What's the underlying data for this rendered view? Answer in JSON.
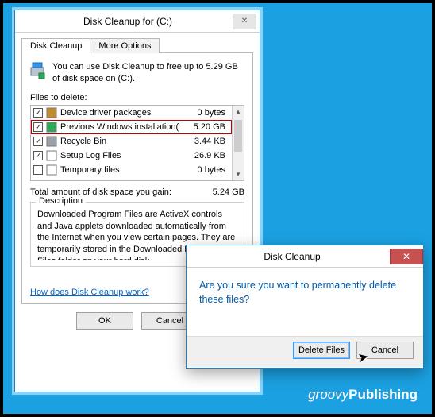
{
  "main_window": {
    "title": "Disk Cleanup for  (C:)",
    "close_glyph": "✕",
    "tabs": {
      "t1": "Disk Cleanup",
      "t2": "More Options"
    },
    "intro_line": "You can use Disk Cleanup to free up to 5.29 GB of disk space on  (C:).",
    "files_to_delete_label": "Files to delete:",
    "rows": [
      {
        "name": "Device driver packages",
        "size": "0 bytes",
        "checked": true,
        "iconColor": "#c08b2f"
      },
      {
        "name": "Previous Windows installation(s)",
        "size": "5.20 GB",
        "checked": true,
        "iconColor": "#2fa85a",
        "highlight": true
      },
      {
        "name": "Recycle Bin",
        "size": "3.44 KB",
        "checked": true,
        "iconColor": "#9aa0a6"
      },
      {
        "name": "Setup Log Files",
        "size": "26.9 KB",
        "checked": true,
        "iconColor": "#ffffff"
      },
      {
        "name": "Temporary files",
        "size": "0 bytes",
        "checked": false,
        "iconColor": "#ffffff"
      }
    ],
    "total_label": "Total amount of disk space you gain:",
    "total_value": "5.24 GB",
    "description_legend": "Description",
    "description_body": "Downloaded Program Files are ActiveX controls and Java applets downloaded automatically from the Internet when you view certain pages. They are temporarily stored in the Downloaded Program Files folder on your hard disk.",
    "help_link": "How does Disk Cleanup work?",
    "ok_label": "OK",
    "cancel_label": "Cancel",
    "scroll_up_glyph": "▴",
    "scroll_down_glyph": "▾"
  },
  "dialog": {
    "title": "Disk Cleanup",
    "close_glyph": "✕",
    "message": "Are you sure you want to permanently delete these files?",
    "delete_label": "Delete Files",
    "cancel_label": "Cancel"
  },
  "watermark_a": "groovy",
  "watermark_b": "Publishing"
}
